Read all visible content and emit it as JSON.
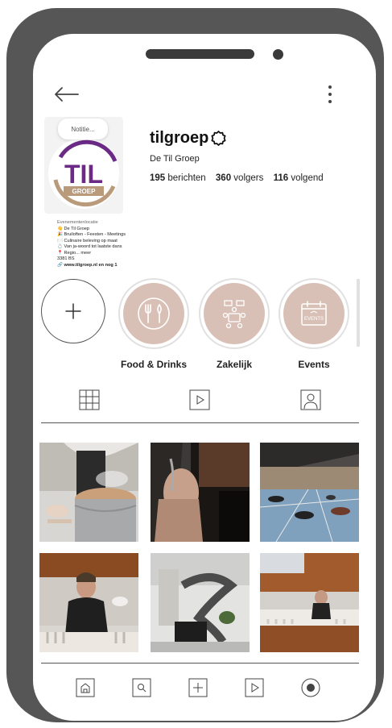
{
  "profile": {
    "username": "tilgroep",
    "full_name": "De Til Groep",
    "note_bubble": "Notitie...",
    "logo_text": "TIL",
    "logo_subtext": "GROEP",
    "stats": {
      "posts_count": "195",
      "posts_label": "berichten",
      "followers_count": "360",
      "followers_label": "volgers",
      "following_count": "116",
      "following_label": "volgend"
    },
    "bio": {
      "category": "Evenementenlocatie",
      "lines": [
        "👋 De Til Groep",
        "🎉 Bruiloften - Feesten - Meetings",
        "🍽️ Culinaire beleving op maat",
        "💍 Van ja-woord tot laatste dans",
        "📍 Regio... meer"
      ],
      "postcode": "3381 BS",
      "link": "www.tilgroep.nl en nog 1"
    }
  },
  "highlights": [
    {
      "label": "Food & Drinks",
      "icon": "food-drinks-icon"
    },
    {
      "label": "Zakelijk",
      "icon": "meeting-icon"
    },
    {
      "label": "Events",
      "icon": "events-calendar-icon"
    }
  ],
  "new_highlight": {
    "icon": "plus-icon"
  },
  "tabs": [
    "grid-icon",
    "reels-icon",
    "tagged-icon"
  ],
  "bottom_nav": [
    "home-icon",
    "search-icon",
    "create-icon",
    "reels-icon",
    "profile-icon"
  ],
  "colors": {
    "phone_frame": "#565656",
    "highlight_fill": "#d9c0b6",
    "logo_purple": "#6b2a86",
    "logo_gold": "#b99a7a"
  }
}
